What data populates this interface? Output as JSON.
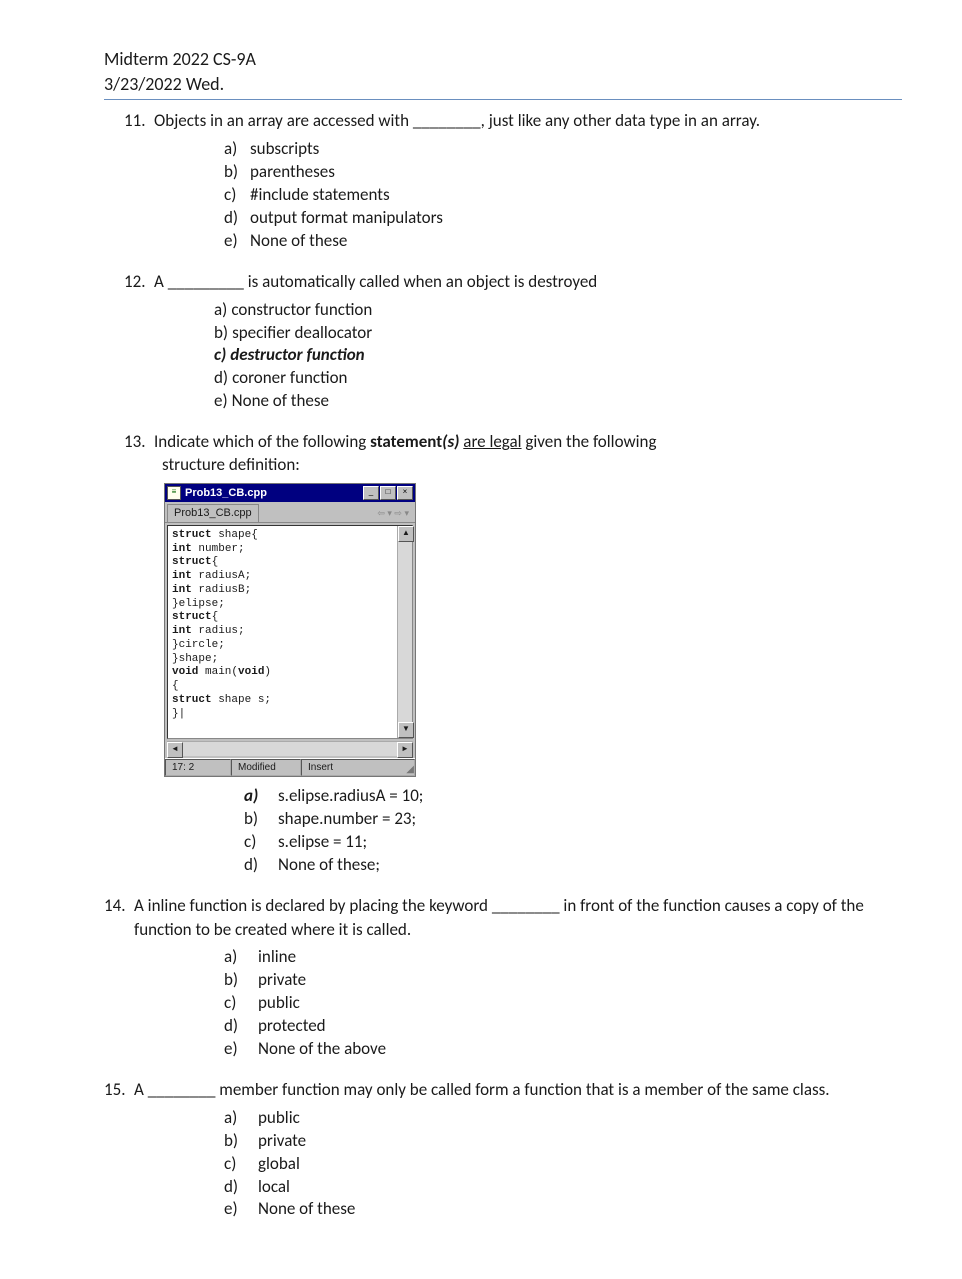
{
  "header": {
    "title": "Midterm 2022 CS-9A",
    "date": "3/23/2022  Wed."
  },
  "q11": {
    "num": "11.",
    "text_a": "Objects in an array are accessed with ",
    "blank": "________",
    "text_b": ", just like any other data type in an array.",
    "opts": [
      {
        "l": "a)",
        "t": "subscripts"
      },
      {
        "l": "b)",
        "t": "parentheses"
      },
      {
        "l": "c)",
        "t": "#include statements"
      },
      {
        "l": "d)",
        "t": "output format manipulators"
      },
      {
        "l": "e)",
        "t": "None of these"
      }
    ]
  },
  "q12": {
    "num": "12.",
    "text_a": "A ",
    "blank": "_________",
    "text_b": " is automatically called when an object is destroyed",
    "opts": [
      {
        "l": "a)",
        "t": "constructor function",
        "em": false
      },
      {
        "l": "b)",
        "t": "specifier deallocator",
        "em": false
      },
      {
        "l": "c)",
        "t": "destructor function",
        "em": true
      },
      {
        "l": "d)",
        "t": "coroner function",
        "em": false
      },
      {
        "l": "e)",
        "t": "None of these",
        "em": false
      }
    ]
  },
  "q13": {
    "num": "13.",
    "text_a": "Indicate which of the following ",
    "bold": "statement",
    "bolditalic": "(s)",
    "text_b": " ",
    "ul": "are legal",
    "text_c": " given the following",
    "text_d": "structure definition:",
    "win_title": "Prob13_CB.cpp",
    "tab": "Prob13_CB.cpp",
    "code_lines": [
      [
        {
          "k": "struct",
          "p": " shape{"
        }
      ],
      [
        {
          "p": "    "
        },
        {
          "k": "int",
          "p": " number;"
        }
      ],
      [
        {
          "p": "    "
        },
        {
          "k": "struct",
          "p": "{"
        }
      ],
      [
        {
          "p": "        "
        },
        {
          "k": "int",
          "p": " radiusA;"
        }
      ],
      [
        {
          "p": "        "
        },
        {
          "k": "int",
          "p": " radiusB;"
        }
      ],
      [
        {
          "p": "    }elipse;"
        }
      ],
      [
        {
          "p": "    "
        },
        {
          "k": "struct",
          "p": "{"
        }
      ],
      [
        {
          "p": "        "
        },
        {
          "k": "int",
          "p": " radius;"
        }
      ],
      [
        {
          "p": "    }circle;"
        }
      ],
      [
        {
          "p": "}shape;"
        }
      ],
      [
        {
          "p": " "
        }
      ],
      [
        {
          "k": "void",
          "p": " main("
        },
        {
          "k": "void",
          "p": ")"
        }
      ],
      [
        {
          "p": "{"
        }
      ],
      [
        {
          "p": "    "
        },
        {
          "k": "struct",
          "p": " shape s;"
        }
      ],
      [
        {
          "p": "}|"
        }
      ]
    ],
    "status": {
      "pos": "17:  2",
      "mode": "Modified",
      "ins": "Insert"
    },
    "opts": [
      {
        "l": "a)",
        "t": "s.elipse.radiusA = 10;",
        "em": true
      },
      {
        "l": "b)",
        "t": "shape.number = 23;",
        "em": false
      },
      {
        "l": "c)",
        "t": "s.elipse  = 11;",
        "em": false
      },
      {
        "l": "d)",
        "t": "None of these;",
        "em": false
      }
    ]
  },
  "q14": {
    "num": "14.",
    "text_a": "A inline  function is declared by placing the keyword ",
    "blank": "________",
    "text_b": " in front of the function causes a copy of the",
    "text_c": "function to be created where it is called.",
    "opts": [
      {
        "l": "a)",
        "t": "inline"
      },
      {
        "l": "b)",
        "t": "private"
      },
      {
        "l": "c)",
        "t": "public"
      },
      {
        "l": "d)",
        "t": "protected"
      },
      {
        "l": "e)",
        "t": "None of the above"
      }
    ]
  },
  "q15": {
    "num": "15.",
    "text_a": "A ",
    "blank": "________",
    "text_b": " member function may only be called form a function that is a member of the same class.",
    "opts": [
      {
        "l": "a)",
        "t": "public"
      },
      {
        "l": "b)",
        "t": "private"
      },
      {
        "l": "c)",
        "t": "global"
      },
      {
        "l": "d)",
        "t": "local"
      },
      {
        "l": "e)",
        "t": "None of these"
      }
    ]
  }
}
